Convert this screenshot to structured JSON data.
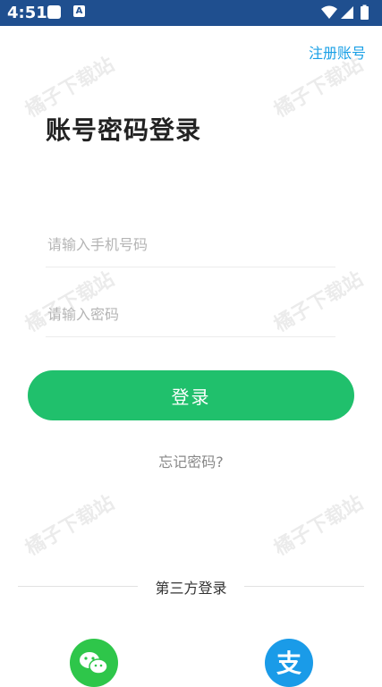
{
  "status_bar": {
    "time": "4:51",
    "notification_icons": [
      "app-square-icon",
      "a-letter-icon"
    ],
    "system_icons": [
      "wifi-icon",
      "cell-signal-icon",
      "battery-icon"
    ],
    "app2_letter": "A"
  },
  "header": {
    "register_label": "注册账号"
  },
  "title": "账号密码登录",
  "form": {
    "phone_placeholder": "请输入手机号码",
    "password_placeholder": "请输入密码",
    "login_label": "登录"
  },
  "forgot_label": "忘记密码?",
  "third_party": {
    "label": "第三方登录",
    "providers": [
      "wechat-icon",
      "alipay-icon"
    ]
  },
  "watermark_text": "橘子下载站",
  "colors": {
    "status_bar": "#1f4f8f",
    "accent_green": "#20c06c",
    "link_blue": "#1aa0e6",
    "wechat_green": "#2ec64a",
    "alipay_blue": "#1a9be8"
  }
}
